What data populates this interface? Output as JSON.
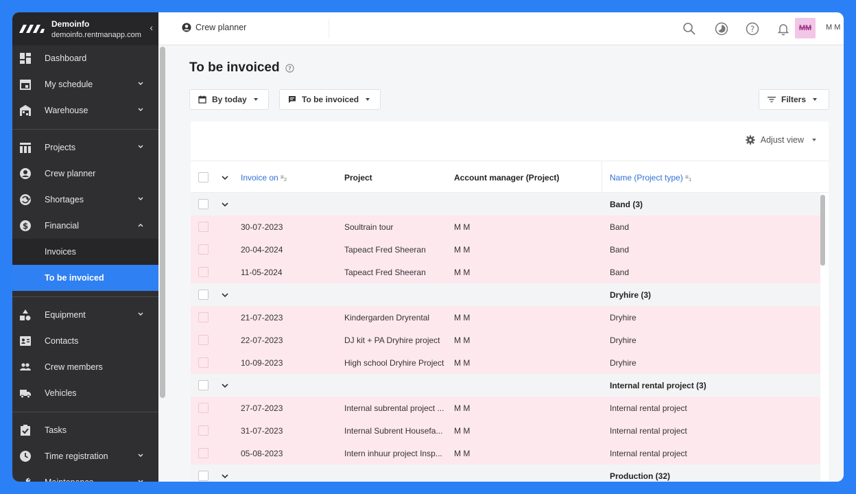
{
  "brand": {
    "name": "Demoinfo",
    "domain": "demoinfo.rentmanapp.com"
  },
  "sidebar": {
    "groups": [
      [
        {
          "label": "Dashboard",
          "icon": "dashboard-icon",
          "chevron": false
        },
        {
          "label": "My schedule",
          "icon": "calendar-icon",
          "chevron": true
        },
        {
          "label": "Warehouse",
          "icon": "warehouse-icon",
          "chevron": true
        }
      ],
      [
        {
          "label": "Projects",
          "icon": "projects-icon",
          "chevron": true
        },
        {
          "label": "Crew planner",
          "icon": "crew-planner-icon",
          "chevron": false
        },
        {
          "label": "Shortages",
          "icon": "shortages-icon",
          "chevron": true
        },
        {
          "label": "Financial",
          "icon": "financial-icon",
          "chevron": true,
          "expanded": true
        }
      ]
    ],
    "financial_sub": [
      {
        "label": "Invoices",
        "active": false
      },
      {
        "label": "To be invoiced",
        "active": true
      }
    ],
    "groups2": [
      [
        {
          "label": "Equipment",
          "icon": "equipment-icon",
          "chevron": true
        },
        {
          "label": "Contacts",
          "icon": "contacts-icon",
          "chevron": false
        },
        {
          "label": "Crew members",
          "icon": "crew-members-icon",
          "chevron": false
        },
        {
          "label": "Vehicles",
          "icon": "vehicles-icon",
          "chevron": false
        }
      ],
      [
        {
          "label": "Tasks",
          "icon": "tasks-icon",
          "chevron": false
        },
        {
          "label": "Time registration",
          "icon": "time-icon",
          "chevron": true
        },
        {
          "label": "Maintenance",
          "icon": "maintenance-icon",
          "chevron": true
        }
      ]
    ]
  },
  "topbar": {
    "crew_planner": "Crew planner",
    "avatar": "MM",
    "user": "M M"
  },
  "page": {
    "title": "To be invoiced",
    "filter_today": "By today",
    "filter_status": "To be invoiced",
    "filters": "Filters",
    "adjust_view": "Adjust view"
  },
  "table": {
    "headers": {
      "invoice_on": "Invoice on",
      "invoice_on_sort": "2",
      "project": "Project",
      "account_manager": "Account manager (Project)",
      "name_type": "Name (Project type)",
      "name_type_sort": "1"
    },
    "groups": [
      {
        "name": "Band (3)",
        "rows": [
          {
            "date": "30-07-2023",
            "project": "Soultrain tour",
            "manager": "M M",
            "type": "Band"
          },
          {
            "date": "20-04-2024",
            "project": "Tapeact Fred Sheeran",
            "manager": "M M",
            "type": "Band"
          },
          {
            "date": "11-05-2024",
            "project": "Tapeact Fred Sheeran",
            "manager": "M M",
            "type": "Band"
          }
        ]
      },
      {
        "name": "Dryhire (3)",
        "rows": [
          {
            "date": "21-07-2023",
            "project": "Kindergarden Dryrental",
            "manager": "M M",
            "type": "Dryhire"
          },
          {
            "date": "22-07-2023",
            "project": "DJ kit + PA Dryhire project",
            "manager": "M M",
            "type": "Dryhire"
          },
          {
            "date": "10-09-2023",
            "project": "High school Dryhire Project",
            "manager": "M M",
            "type": "Dryhire"
          }
        ]
      },
      {
        "name": "Internal rental project (3)",
        "rows": [
          {
            "date": "27-07-2023",
            "project": "Internal subrental project ...",
            "manager": "M M",
            "type": "Internal rental project"
          },
          {
            "date": "31-07-2023",
            "project": "Internal Subrent Housefa...",
            "manager": "M M",
            "type": "Internal rental project"
          },
          {
            "date": "05-08-2023",
            "project": "Intern inhuur project Insp...",
            "manager": "M M",
            "type": "Internal rental project"
          }
        ]
      },
      {
        "name": "Production (32)",
        "rows": []
      }
    ]
  }
}
